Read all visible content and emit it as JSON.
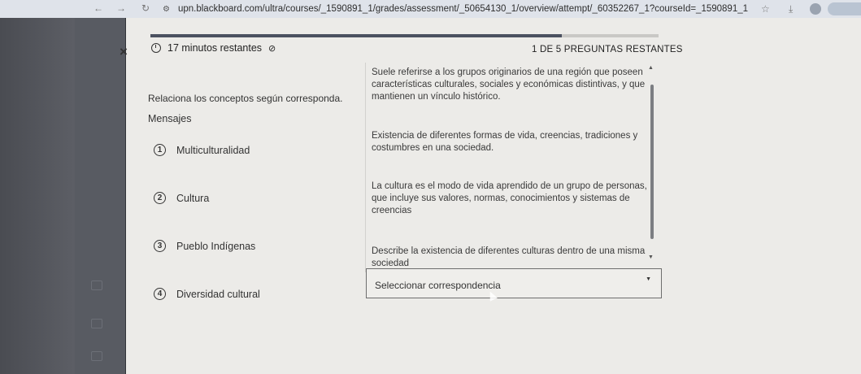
{
  "browser": {
    "url": "upn.blackboard.com/ultra/courses/_1590891_1/grades/assessment/_50654130_1/overview/attempt/_60352267_1?courseId=_1590891_1",
    "icons": [
      "back-icon",
      "forward-icon",
      "reload-icon",
      "site-settings-icon",
      "star-icon",
      "download-icon"
    ]
  },
  "assessment": {
    "close_label": "×",
    "timer_text": "17 minutos restantes",
    "remaining_text": "1 DE 5 PREGUNTAS RESTANTES",
    "progress_fraction": 0.81,
    "instruction": "Relaciona los conceptos según corresponda.",
    "section_title": "Mensajes",
    "concepts": [
      {
        "number": "1",
        "label": "Multiculturalidad"
      },
      {
        "number": "2",
        "label": "Cultura"
      },
      {
        "number": "3",
        "label": "Pueblo Indígenas"
      },
      {
        "number": "4",
        "label": "Diversidad cultural"
      }
    ],
    "matches": [
      {
        "text": "Suele referirse a los grupos originarios de una región que poseen características culturales, sociales y económicas distintivas, y que mantienen un vínculo histórico."
      },
      {
        "text": "Existencia de diferentes formas de vida, creencias, tradiciones y costumbres en una sociedad."
      },
      {
        "text": "La cultura es el modo de vida aprendido de un grupo de personas, que incluye sus valores, normas, conocimientos y sistemas de creencias"
      },
      {
        "text": "Describe la existencia de diferentes culturas dentro de una misma sociedad"
      }
    ],
    "select": {
      "placeholder": "Seleccionar correspondencia"
    }
  },
  "colors": {
    "panel_bg": "#ecebe8",
    "progress_fill": "#4b5160",
    "sidebar": "#585b62"
  }
}
